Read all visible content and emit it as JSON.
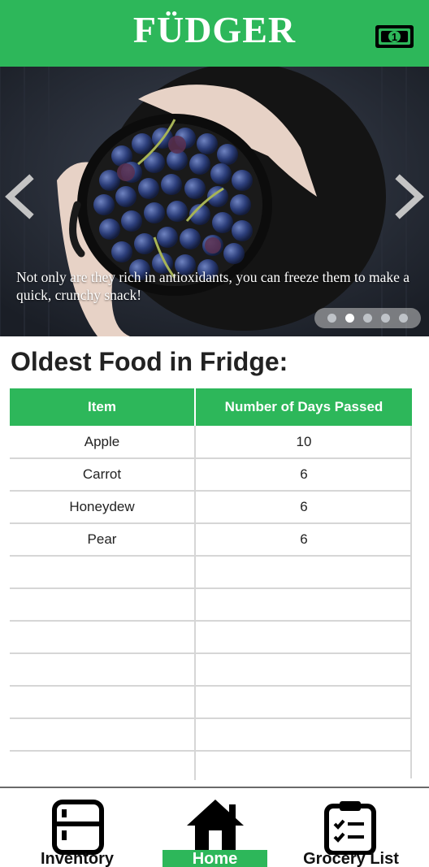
{
  "header": {
    "title": "FÜDGER",
    "brand_color": "#2db75a",
    "money_icon": "dollar-bill-icon"
  },
  "carousel": {
    "caption": "Not only are they rich in antioxidants, you can freeze them to make a quick, crunchy snack!",
    "slide_count": 5,
    "active_slide": 2,
    "prev_icon": "chevron-left-icon",
    "next_icon": "chevron-right-icon"
  },
  "oldest_food": {
    "heading": "Oldest Food in Fridge:",
    "columns": [
      "Item",
      "Number of Days Passed"
    ],
    "rows": [
      {
        "item": "Apple",
        "days": "10"
      },
      {
        "item": "Carrot",
        "days": "6"
      },
      {
        "item": "Honeydew",
        "days": "6"
      },
      {
        "item": "Pear",
        "days": "6"
      },
      {
        "item": "",
        "days": ""
      },
      {
        "item": "",
        "days": ""
      },
      {
        "item": "",
        "days": ""
      },
      {
        "item": "",
        "days": ""
      },
      {
        "item": "",
        "days": ""
      },
      {
        "item": "",
        "days": ""
      },
      {
        "item": "",
        "days": ""
      }
    ]
  },
  "bottom_nav": {
    "items": [
      {
        "label": "Inventory",
        "icon": "fridge-icon",
        "active": false
      },
      {
        "label": "Home",
        "icon": "home-icon",
        "active": true
      },
      {
        "label": "Grocery List",
        "icon": "clipboard-icon",
        "active": false
      }
    ]
  }
}
